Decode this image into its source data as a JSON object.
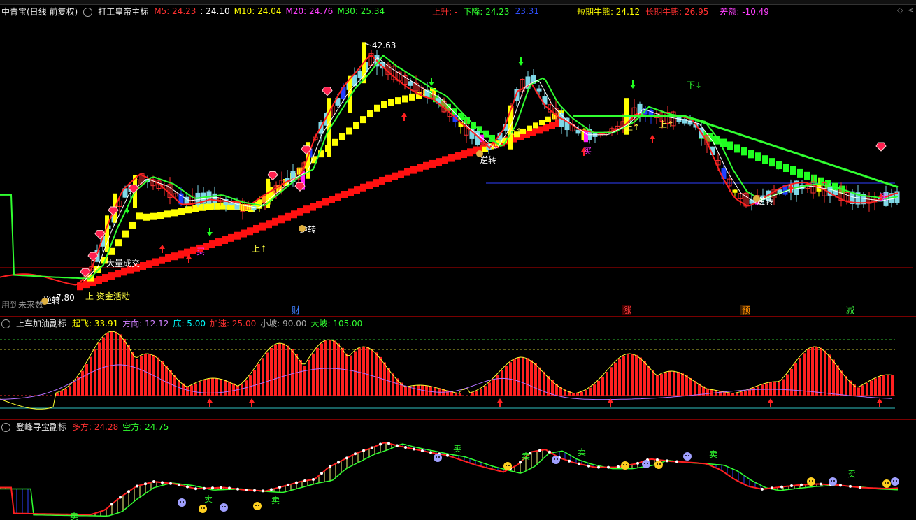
{
  "main": {
    "stock": "中青宝(日线 前复权)",
    "indicator": "打工皇帝主标",
    "ma": [
      {
        "label": "M5:",
        "value": "24.23",
        "color": "#ff3030"
      },
      {
        "label": ":",
        "value": "24.10",
        "color": "#ffffff"
      },
      {
        "label": "M10:",
        "value": "24.04",
        "color": "#ffff00"
      },
      {
        "label": "M20:",
        "value": "24.76",
        "color": "#ff40ff"
      },
      {
        "label": "M30:",
        "value": "25.34",
        "color": "#30ff30"
      }
    ],
    "up_label": "上升: -",
    "down_label": "下降: 24.23",
    "extra_val": "23.31",
    "short_label": "短期牛熊: 24.12",
    "long_label": "长期牛熊: 26.95",
    "diff_label": "差额: -10.49",
    "annotations": {
      "high": "42.63",
      "low": "7.80",
      "big_volume": "大量成交",
      "capital": "上 资金活动",
      "reverse": "逆转",
      "buy": "买",
      "up": "上↑",
      "down": "下↓"
    },
    "future_note": "用到未来数",
    "events": [
      "财",
      "涨",
      "预",
      "减"
    ]
  },
  "sub1": {
    "title": "上车加油副标",
    "items": [
      {
        "label": "起飞:",
        "value": "33.91",
        "color": "#ffff00"
      },
      {
        "label": "方向:",
        "value": "12.12",
        "color": "#d080ff"
      },
      {
        "label": "底:",
        "value": "5.00",
        "color": "#00ffff"
      },
      {
        "label": "加速:",
        "value": "25.00",
        "color": "#ff3030"
      },
      {
        "label": "小坡:",
        "value": "90.00",
        "color": "#aaaaaa"
      },
      {
        "label": "大坡:",
        "value": "105.00",
        "color": "#30ff30"
      }
    ]
  },
  "sub2": {
    "title": "登峰寻宝副标",
    "items": [
      {
        "label": "多方:",
        "value": "24.28",
        "color": "#ff3030"
      },
      {
        "label": "空方:",
        "value": "24.75",
        "color": "#30ff30"
      }
    ],
    "sell": "卖"
  },
  "colors": {
    "bg": "#000000",
    "up": "#ff2020",
    "down": "#30ff30",
    "yellow": "#ffff00",
    "grid": "#7a0000"
  }
}
